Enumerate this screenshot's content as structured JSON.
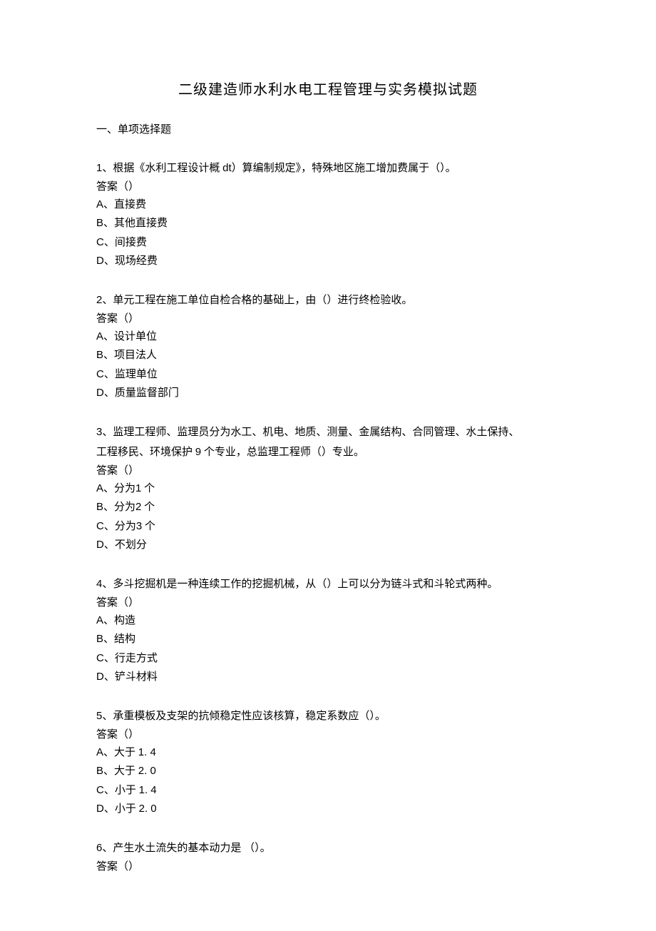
{
  "title": "二级建造师水利水电工程管理与实务模拟试题",
  "section_header": "一、单项选择题",
  "questions": [
    {
      "num": "1",
      "stem_a": "、根据《水利工程设计概 ",
      "stem_b": "dt",
      "stem_c": "）算编制规定》，特殊地区施工增加费属于（）。",
      "answer": "答案（）",
      "opts": {
        "A": "、直接费",
        "B": "、其他直接费",
        "C": "、间接费",
        "D": "、现场经费"
      }
    },
    {
      "num": "2",
      "stem_a": "、单元工程在施工单位自检合格的基础上",
      "stem_b": "",
      "stem_c": "，由（）进行终检验收。",
      "answer": "答案（）",
      "opts": {
        "A": "、设计单位",
        "B": "、项目法人",
        "C": "、监理单位",
        "D": "、质量监督部门"
      }
    },
    {
      "num": "3",
      "stem_line1": "、监理工程师、监理员分为水工、机电、地质、测量、金属结构、合同管理、水土保持、",
      "stem_line2a": "工程移民、环境保护 ",
      "stem_line2b": "9",
      "stem_line2c": " 个专业，总监理工程师（）专业。",
      "answer": "答案（）",
      "opts_num": {
        "A": {
          "pre": "、分为",
          "n": "1",
          "suf": " 个"
        },
        "B": {
          "pre": "、分为",
          "n": "2",
          "suf": " 个"
        },
        "C": {
          "pre": "、分为",
          "n": "3",
          "suf": " 个"
        }
      },
      "optD": "、不划分"
    },
    {
      "num": "4",
      "stem_a": "、多斗挖掘机是一种连续工作的挖掘机械",
      "stem_b": "",
      "stem_c": "，从（）上可以分为链斗式和斗轮式两种。",
      "answer": "答案（）",
      "opts": {
        "A": "、构造",
        "B": "、结构",
        "C": "、行走方式",
        "D": "、铲斗材料"
      }
    },
    {
      "num": "5",
      "stem_a": "、承重模板及支架的抗倾稳定性应该核算",
      "stem_b": "",
      "stem_c": "，稳定系数应（）。",
      "answer": "答案（）",
      "opts_num": {
        "A": {
          "pre": "、大于 ",
          "n": "1. 4",
          "suf": ""
        },
        "B": {
          "pre": "、大于 ",
          "n": "2. 0",
          "suf": ""
        },
        "C": {
          "pre": "、小于 ",
          "n": "1. 4",
          "suf": ""
        },
        "D": {
          "pre": "、小于 ",
          "n": "2. 0",
          "suf": ""
        }
      }
    },
    {
      "num": "6",
      "stem_a": "、产生水土流失的基本动力是",
      "stem_b": "",
      "stem_c": " （）。",
      "answer": "答案（）"
    }
  ]
}
